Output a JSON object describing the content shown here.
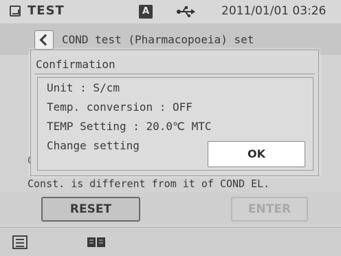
{
  "status_bar": {
    "title": "TEST",
    "mode_badge": "A",
    "usb_icon": "usb-icon",
    "datetime": "2011/01/01 03:26"
  },
  "header": {
    "back_icon": "chevron-left-icon",
    "title": "COND test (Pharmacopoeia) set"
  },
  "background": {
    "left_fragment": "C",
    "warning": "Const. is different from it of COND EL."
  },
  "dialog": {
    "title": "Confirmation",
    "lines": [
      "Unit : S/cm",
      "Temp. conversion : OFF",
      "TEMP Setting : 20.0℃ MTC",
      "Change setting"
    ],
    "ok_label": "OK"
  },
  "actions": {
    "reset_label": "RESET",
    "enter_label": "ENTER"
  },
  "bottom_bar": {
    "menu_icon": "menu-icon",
    "book_icon": "book-icon"
  }
}
